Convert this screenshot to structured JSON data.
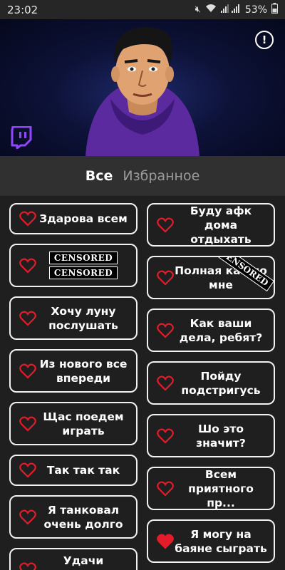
{
  "status_bar": {
    "time": "23:02",
    "battery": "53%"
  },
  "header": {
    "info_symbol": "!"
  },
  "tabs": [
    {
      "label": "Все"
    },
    {
      "label": "Избранное"
    }
  ],
  "censor_text": "CENSORED",
  "colors": {
    "heart": "#e31c2b",
    "background": "#1f1f1f",
    "tab_bar": "#303030",
    "twitch": "#9146ff"
  },
  "sounds_left": [
    {
      "label": "Здарова всем",
      "favorite": false
    },
    {
      "label": "",
      "censored": true,
      "favorite": false
    },
    {
      "label": "Хочу луну послушать",
      "favorite": false
    },
    {
      "label": "Из нового все впереди",
      "favorite": false
    },
    {
      "label": "Щас поедем играть",
      "favorite": false
    },
    {
      "label": "Так так так",
      "favorite": false
    },
    {
      "label": "Я танковал очень долго",
      "favorite": false
    },
    {
      "label": "Удачи",
      "favorite": false
    }
  ],
  "sounds_right": [
    {
      "label": "Буду афк дома отдыхать",
      "favorite": false
    },
    {
      "label": "Полная как по мне",
      "favorite": false,
      "partially_censored": true
    },
    {
      "label": "Как ваши дела, ребят?",
      "favorite": false
    },
    {
      "label": "Пойду подстригусь",
      "favorite": false
    },
    {
      "label": "Шо это значит?",
      "favorite": false
    },
    {
      "label": "Всем приятного пр...",
      "favorite": false
    },
    {
      "label": "Я могу на баяне сыграть",
      "favorite": true
    }
  ]
}
